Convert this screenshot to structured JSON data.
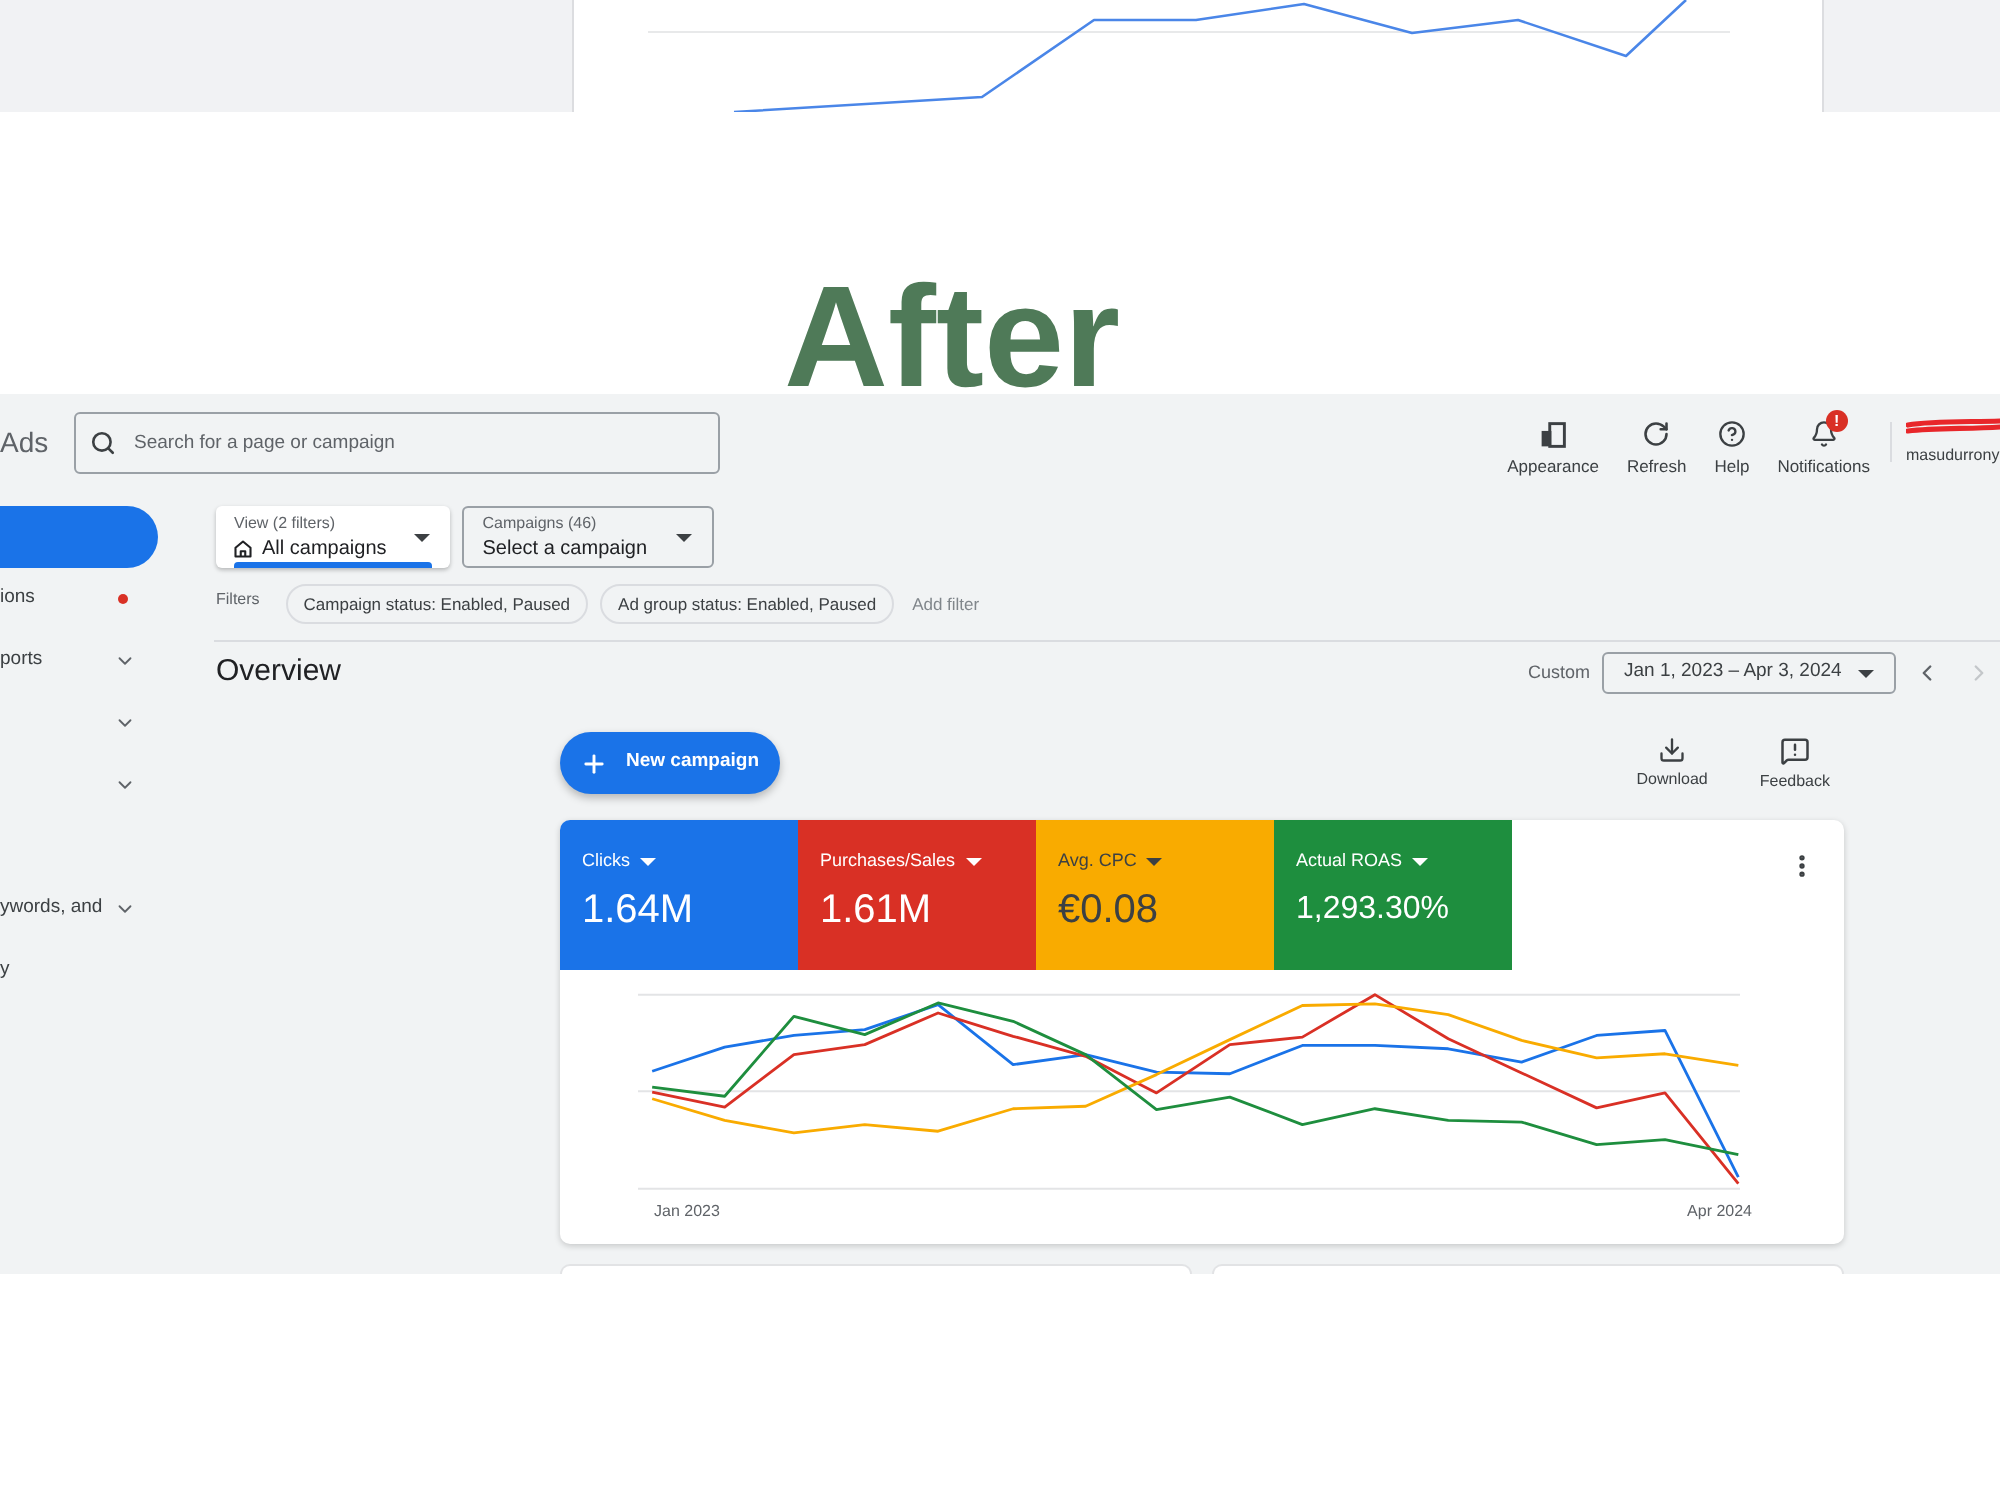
{
  "heading": "After",
  "header": {
    "logo": "Ads",
    "search": {
      "placeholder": "Search for a page or campaign"
    },
    "toolbar": [
      {
        "kind": "appearance",
        "label": "Appearance"
      },
      {
        "kind": "refresh",
        "label": "Refresh"
      },
      {
        "kind": "help",
        "label": "Help"
      },
      {
        "kind": "notifications",
        "label": "Notifications",
        "badge": "!"
      }
    ],
    "account": "masudurrony"
  },
  "sidebar": {
    "items": [
      {
        "label": "ions",
        "alert": true,
        "expandable": false
      },
      {
        "label": "ports",
        "alert": false,
        "expandable": true
      },
      {
        "alert": false,
        "expandable": true
      },
      {
        "alert": false,
        "expandable": true
      },
      {
        "label": "ywords, and",
        "alert": false,
        "expandable": true
      },
      {
        "label": "y",
        "alert": false,
        "expandable": false
      }
    ]
  },
  "selectors": [
    {
      "kind": "view",
      "label": "View (2 filters)",
      "value": "All campaigns",
      "active": true
    },
    {
      "kind": "campaign",
      "label": "Campaigns (46)",
      "value": "Select a campaign",
      "active": false
    }
  ],
  "filters": {
    "label": "Filters",
    "chips": [
      "Campaign status: Enabled, Paused",
      "Ad group status: Enabled, Paused"
    ],
    "add": "Add filter"
  },
  "overview": {
    "title": "Overview",
    "range_label": "Custom",
    "date_range": "Jan 1, 2023 – Apr 3, 2024",
    "pager": [
      {
        "kind": "previous",
        "disabled": false
      },
      {
        "kind": "next",
        "disabled": true
      }
    ]
  },
  "new_campaign": {
    "label": "New campaign"
  },
  "actions": [
    {
      "kind": "download",
      "label": "Download"
    },
    {
      "kind": "feedback",
      "label": "Feedback"
    }
  ],
  "metrics": [
    {
      "label": "Clicks",
      "value": "1.64M",
      "color": "#1a73e8"
    },
    {
      "label": "Purchases/Sales",
      "value": "1.61M",
      "color": "#d93025"
    },
    {
      "label": "Avg. CPC",
      "value": "€0.08",
      "color": "#f9ab00"
    },
    {
      "label": "Actual ROAS",
      "value": "1,293.30%",
      "color": "#1e8e3e"
    }
  ],
  "chart": {
    "x_labels": [
      "Jan 2023",
      "Apr 2024"
    ]
  }
}
